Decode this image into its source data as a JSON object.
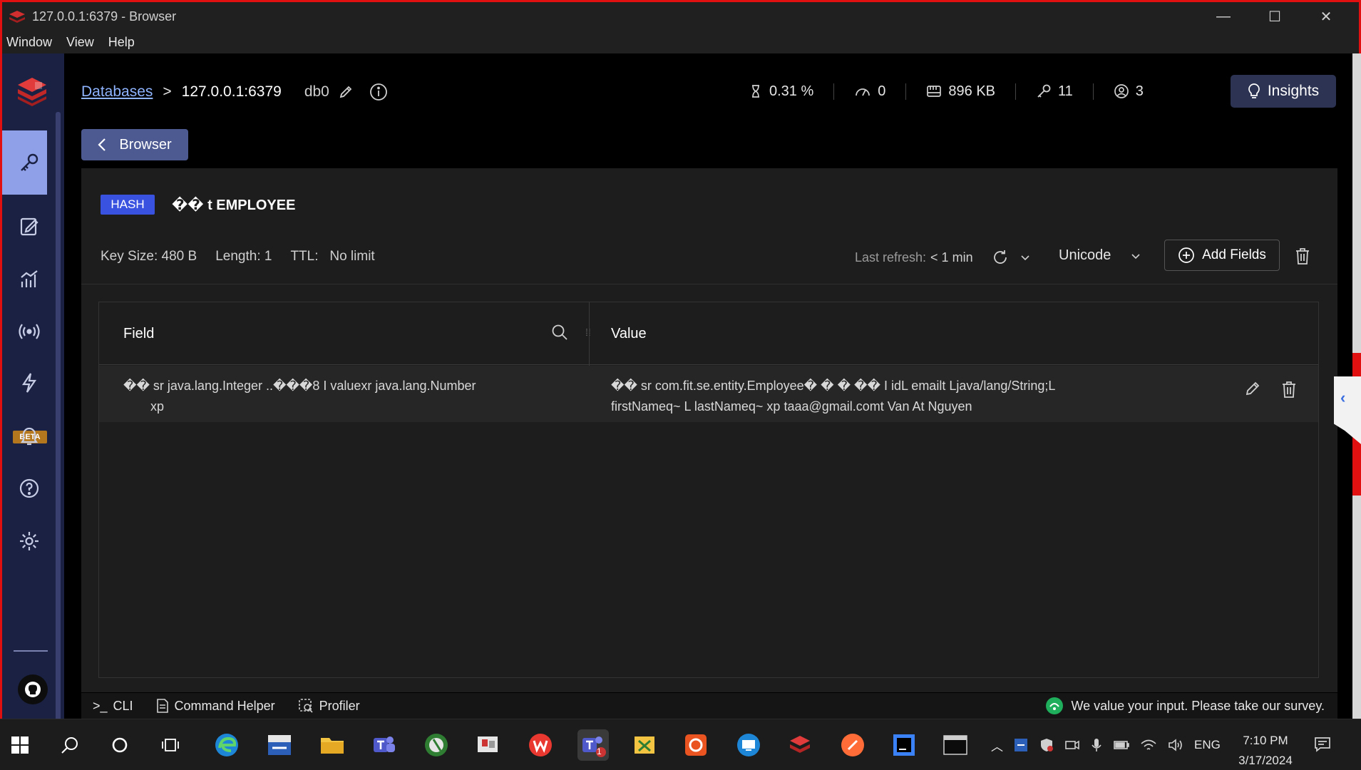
{
  "window": {
    "title": "127.0.0.1:6379 - Browser",
    "minimize": "—",
    "maximize": "☐",
    "close": "✕"
  },
  "menu": [
    "Window",
    "View",
    "Help"
  ],
  "sidebar": {
    "beta_label": "BETA",
    "items": [
      "browser",
      "workbench",
      "analytics",
      "pub-sub",
      "triggers",
      "notifications",
      "help",
      "settings"
    ]
  },
  "breadcrumb": {
    "databases": "Databases",
    "separator": ">",
    "host": "127.0.0.1:6379",
    "db": "db0"
  },
  "stats": {
    "cpu": "0.31 %",
    "ops": "0",
    "memory": "896 KB",
    "keys": "11",
    "clients": "3"
  },
  "insights_label": "Insights",
  "back_label": "Browser",
  "key": {
    "type": "HASH",
    "name": "�� t EMPLOYEE",
    "size": "Key Size: 480 B",
    "length": "Length: 1",
    "ttl_label": "TTL:",
    "ttl_value": "No limit",
    "last_refresh_label": "Last refresh:",
    "last_refresh_value": "< 1 min",
    "format": "Unicode",
    "add_fields_label": "Add Fields"
  },
  "table": {
    "headers": {
      "field": "Field",
      "value": "Value"
    },
    "rows": [
      {
        "field_line1": "�� sr java.lang.Integer ..���8 I valuexr java.lang.Number",
        "field_line2": "xp",
        "value_line1": "�� sr com.fit.se.entity.Employee� � � �� I idL emailt Ljava/lang/String;L",
        "value_line2": "firstNameq~ L lastNameq~ xp taaa@gmail.comt Van At Nguyen"
      }
    ]
  },
  "bottom": {
    "cli": "CLI",
    "cli_prefix": ">_",
    "command_helper": "Command Helper",
    "profiler": "Profiler",
    "survey": "We value your input. Please take our survey."
  },
  "taskbar": {
    "language": "ENG",
    "time": "7:10 PM",
    "date": "3/17/2024",
    "teams_badge": "1"
  },
  "colors": {
    "accent": "#3a52e0",
    "sidebar": "#1a2142",
    "active_nav": "#8fa0e8",
    "link": "#8fb4ff",
    "frame": "#e01010"
  }
}
